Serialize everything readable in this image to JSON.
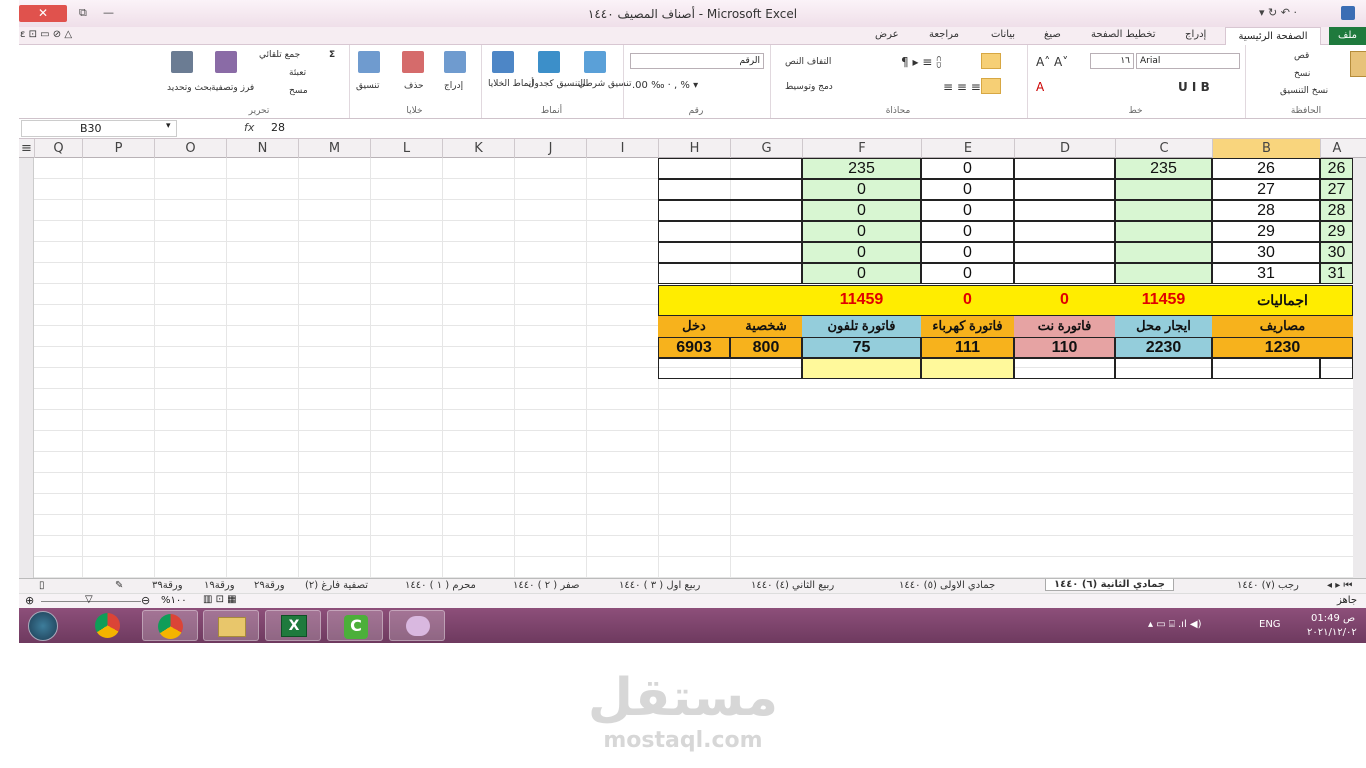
{
  "window": {
    "title": "أصناف المصيف ١٤٤٠ - Microsoft Excel"
  },
  "ribbon_tabs": {
    "file": "ملف",
    "home": "الصفحة الرئيسية",
    "insert": "إدراج",
    "page_layout": "تخطيط الصفحة",
    "formulas": "صيغ",
    "data": "بيانات",
    "review": "مراجعة",
    "view": "عرض"
  },
  "ribbon": {
    "font_name": "Arial",
    "font_size": "١٦",
    "number_format": "الرقم",
    "wrap_text": "التفاف النص",
    "merge_center": "دمج وتوسيط",
    "cond_format": "تنسيق شرطي",
    "format_table": "التنسيق كجدول",
    "cell_styles": "أنماط الخلايا",
    "insert": "إدراج",
    "delete": "حذف",
    "format": "تنسيق",
    "autosum": "جمع تلقائي",
    "fill": "تعبئة",
    "clear": "مسح",
    "sort": "فرز وتصفية",
    "find": "بحث وتحديد",
    "cut": "قص",
    "copy": "نسخ",
    "format_painter": "نسخ التنسيق",
    "groups": {
      "clipboard": "الحافظة",
      "font": "خط",
      "alignment": "محاذاة",
      "number": "رقم",
      "styles": "أنماط",
      "cells": "خلايا",
      "editing": "تحرير"
    }
  },
  "formula_bar": {
    "name_box": "B30",
    "fx": "fx",
    "value": "28"
  },
  "columns": [
    "A",
    "B",
    "C",
    "D",
    "E",
    "F",
    "G",
    "H",
    "I",
    "J",
    "K",
    "L",
    "M",
    "N",
    "O",
    "P",
    "Q"
  ],
  "sheet": {
    "rows": [
      {
        "a": "26",
        "b": "26",
        "c": "235",
        "e": "0",
        "f": "235"
      },
      {
        "a": "27",
        "b": "27",
        "c": "",
        "e": "0",
        "f": "0"
      },
      {
        "a": "28",
        "b": "28",
        "c": "",
        "e": "0",
        "f": "0"
      },
      {
        "a": "29",
        "b": "29",
        "c": "",
        "e": "0",
        "f": "0"
      },
      {
        "a": "30",
        "b": "30",
        "c": "",
        "e": "0",
        "f": "0"
      },
      {
        "a": "31",
        "b": "31",
        "c": "",
        "e": "0",
        "f": "0"
      }
    ],
    "totals": {
      "label": "اجماليات",
      "c": "11459",
      "d": "0",
      "e": "0",
      "f": "11459"
    },
    "headers": {
      "b": "مصاريف",
      "c": "ايجار محل",
      "d": "فاتورة نت",
      "e": "فاتورة كهرباء",
      "f": "فاتورة تلفون",
      "g": "شخصية",
      "h": "دخل"
    },
    "values": {
      "b": "1230",
      "c": "2230",
      "d": "110",
      "e": "111",
      "f": "75",
      "g": "800",
      "h": "6903"
    }
  },
  "sheet_tabs": [
    "رجب (٧) ١٤٤٠",
    "جمادي الثانية (٦) ١٤٤٠",
    "جمادي الاولى (٥) ١٤٤٠",
    "ربيع الثاني (٤) ١٤٤٠",
    "ربيع اول ( ٣ ) ١٤٤٠",
    "صفر ( ٢ ) ١٤٤٠",
    "محرم ( ١ ) ١٤٤٠",
    "تصفية فارغ (٢)",
    "ورقة٢٩",
    "ورقة١٩",
    "ورقة٣٩"
  ],
  "status": {
    "zoom": "%١٠٠",
    "ready": "جاهز"
  },
  "taskbar": {
    "lang": "ENG",
    "time": "01:49 ص",
    "date": "٢٠٢١/١٢/٠٢"
  },
  "watermark": {
    "arabic": "مستقل",
    "latin": "mostaql.com"
  }
}
